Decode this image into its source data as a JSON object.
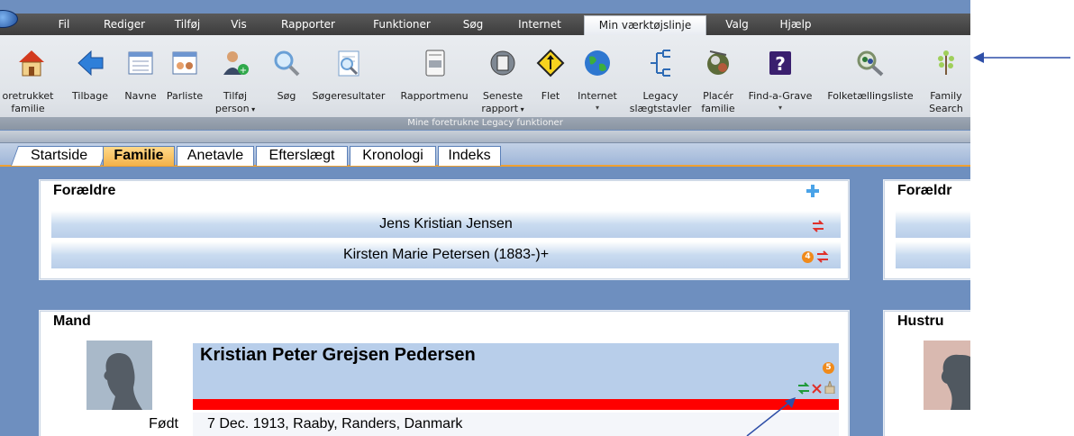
{
  "menu": {
    "items": [
      {
        "label": "Fil"
      },
      {
        "label": "Rediger"
      },
      {
        "label": "Tilføj"
      },
      {
        "label": "Vis"
      },
      {
        "label": "Rapporter"
      },
      {
        "label": "Funktioner"
      },
      {
        "label": "Søg"
      },
      {
        "label": "Internet"
      },
      {
        "label": "Min værktøjslinje"
      },
      {
        "label": "Valg"
      },
      {
        "label": "Hjælp"
      }
    ],
    "active": "Min værktøjslinje"
  },
  "ribbon": {
    "buttons": [
      {
        "l1": "oretrukket",
        "l2": "familie",
        "icon": "house-icon"
      },
      {
        "l1": "Tilbage",
        "l2": "",
        "icon": "back-arrow-icon"
      },
      {
        "l1": "Navne",
        "l2": "",
        "icon": "names-list-icon"
      },
      {
        "l1": "Parliste",
        "l2": "",
        "icon": "couples-list-icon"
      },
      {
        "l1": "Tilføj",
        "l2": "person",
        "icon": "add-person-icon"
      },
      {
        "l1": "Søg",
        "l2": "",
        "icon": "search-icon"
      },
      {
        "l1": "Søgeresultater",
        "l2": "",
        "icon": "search-results-icon"
      },
      {
        "l1": "Rapportmenu",
        "l2": "",
        "icon": "report-menu-icon"
      },
      {
        "l1": "Seneste",
        "l2": "rapport",
        "icon": "recent-report-icon"
      },
      {
        "l1": "Flet",
        "l2": "",
        "icon": "merge-icon"
      },
      {
        "l1": "Internet",
        "l2": "",
        "icon": "globe-icon"
      },
      {
        "l1": "Legacy",
        "l2": "slægtstavler",
        "icon": "charts-icon"
      },
      {
        "l1": "Placér",
        "l2": "familie",
        "icon": "place-family-icon"
      },
      {
        "l1": "Find-a-Grave",
        "l2": "",
        "icon": "find-a-grave-icon"
      },
      {
        "l1": "Folketællingsliste",
        "l2": "",
        "icon": "census-icon"
      },
      {
        "l1": "Family",
        "l2": "Search",
        "icon": "family-search-icon"
      }
    ],
    "group_label": "Mine foretrukne Legacy funktioner"
  },
  "tabs": [
    "Startside",
    "Familie",
    "Anetavle",
    "Efterslægt",
    "Kronologi",
    "Indeks"
  ],
  "active_tab": "Familie",
  "parents_panel": {
    "title": "Forældre",
    "father": "Jens Kristian Jensen",
    "mother": "Kirsten Marie Petersen (1883-)+",
    "mother_badge": "4"
  },
  "parents_panel_right": {
    "title": "Forældr"
  },
  "husband_panel": {
    "title": "Mand",
    "name": "Kristian Peter Grejsen Pedersen",
    "badge": "5",
    "born_label": "Født",
    "born_value": "7 Dec. 1913, Raaby, Randers, Danmark"
  },
  "wife_panel": {
    "title": "Hustru"
  },
  "colors": {
    "menubar": "#4a4a4a",
    "active_tab": "#f3b24a",
    "name_highlight": "#b8ceea",
    "red_bar": "#ff0000",
    "badge": "#f08a1a",
    "annotation_arrow": "#2f4fa8"
  }
}
